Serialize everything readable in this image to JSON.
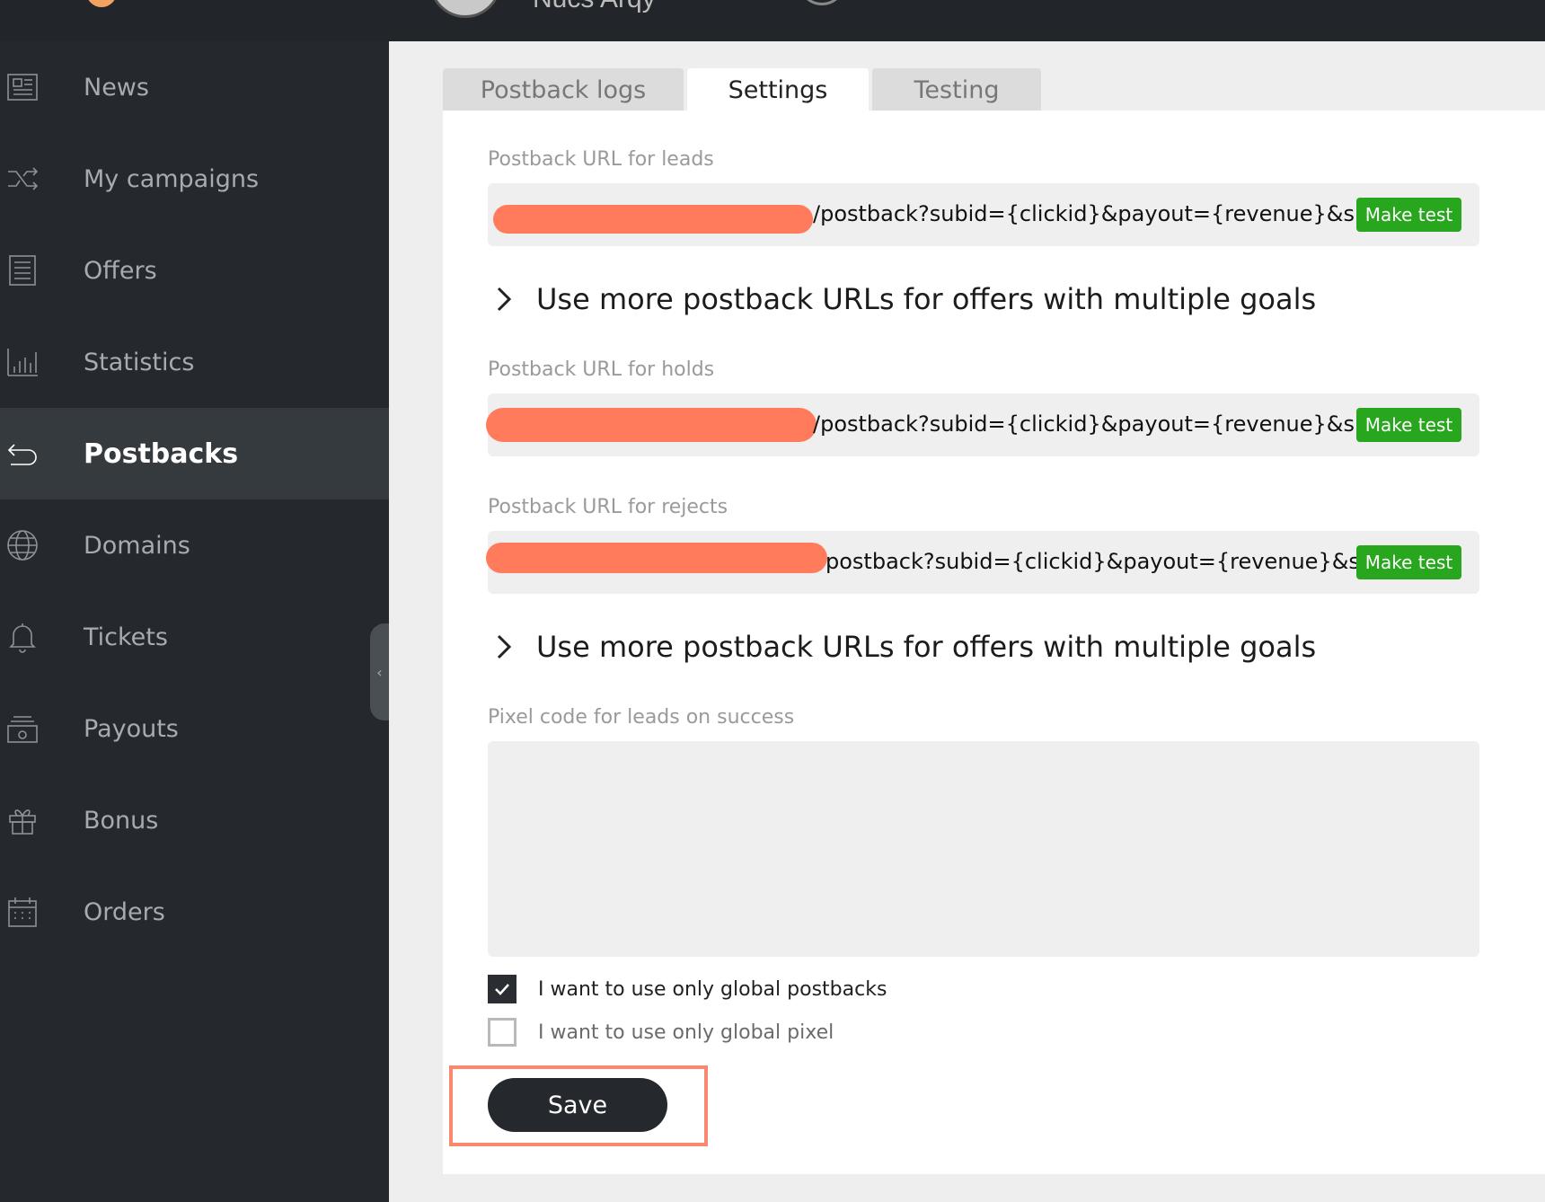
{
  "header": {
    "username": "Nucs Arqy"
  },
  "sidebar": {
    "items": [
      {
        "label": "News",
        "icon": "newspaper-icon"
      },
      {
        "label": "My campaigns",
        "icon": "shuffle-icon"
      },
      {
        "label": "Offers",
        "icon": "document-list-icon"
      },
      {
        "label": "Statistics",
        "icon": "bar-chart-icon"
      },
      {
        "label": "Postbacks",
        "icon": "return-arrow-icon",
        "active": true
      },
      {
        "label": "Domains",
        "icon": "globe-icon"
      },
      {
        "label": "Tickets",
        "icon": "bell-icon"
      },
      {
        "label": "Payouts",
        "icon": "money-stack-icon"
      },
      {
        "label": "Bonus",
        "icon": "gift-icon"
      },
      {
        "label": "Orders",
        "icon": "calendar-icon"
      }
    ],
    "collapse_glyph": "‹"
  },
  "tabs": [
    {
      "label": "Postback logs",
      "active": false
    },
    {
      "label": "Settings",
      "active": true
    },
    {
      "label": "Testing",
      "active": false
    }
  ],
  "settings": {
    "leads": {
      "label": "Postback URL for leads",
      "url_suffix": "/postback?subid={clickid}&payout={revenue}&s...",
      "button": "Make test"
    },
    "expander_1": "Use more postback URLs for offers with multiple goals",
    "holds": {
      "label": "Postback URL for holds",
      "url_suffix": "/postback?subid={clickid}&payout={revenue}&s...",
      "button": "Make test"
    },
    "rejects": {
      "label": "Postback URL for rejects",
      "url_suffix": "postback?subid={clickid}&payout={revenue}&s...",
      "button": "Make test"
    },
    "expander_2": "Use more postback URLs for offers with multiple goals",
    "pixel": {
      "label": "Pixel code for leads on success",
      "value": ""
    },
    "checkboxes": [
      {
        "label": "I want to use only global postbacks",
        "checked": true
      },
      {
        "label": "I want to use only global pixel",
        "checked": false
      }
    ],
    "save_label": "Save"
  },
  "colors": {
    "sidebar_bg": "#25282c",
    "accent_green": "#28a71e",
    "redaction": "#ff7b5c",
    "highlight": "#f8896e"
  }
}
